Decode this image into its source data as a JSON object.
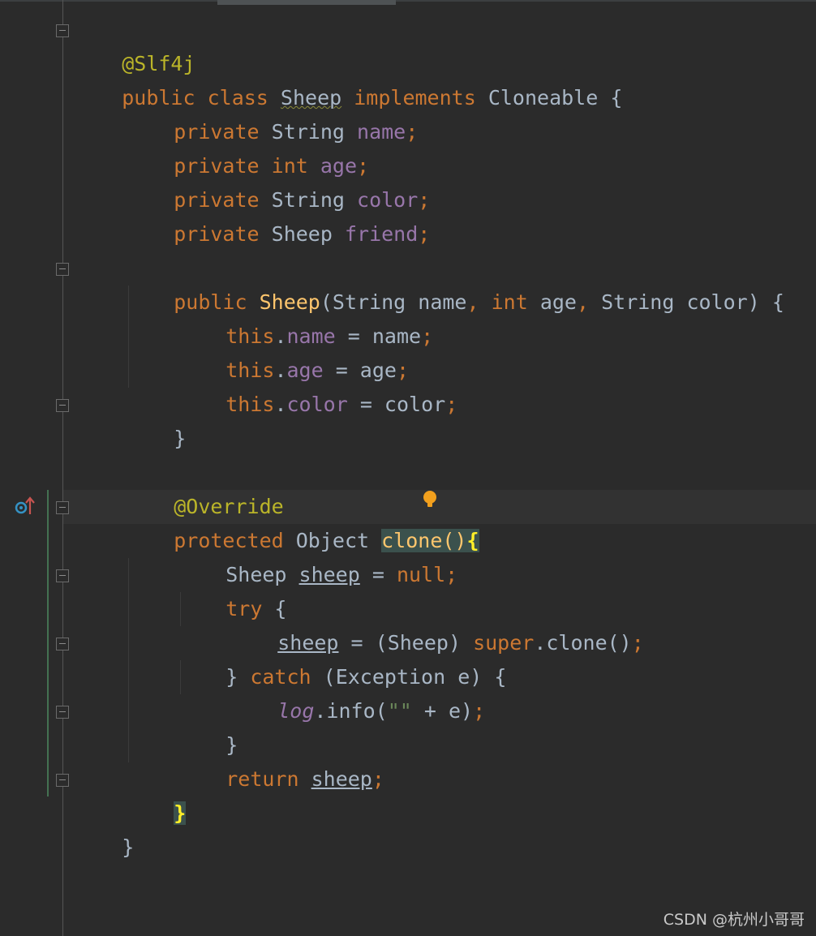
{
  "lines": {
    "l1": {
      "ann": "@Slf4j"
    },
    "l2": {
      "public": "public",
      "cls": "class",
      "name": "Sheep",
      "impl": "implements",
      "iface": "Cloneable",
      "brace": "{"
    },
    "l3": {
      "kw": "private",
      "type": "String",
      "field": "name",
      "semi": ";"
    },
    "l4": {
      "kw": "private",
      "type": "int",
      "field": "age",
      "semi": ";"
    },
    "l5": {
      "kw": "private",
      "type": "String",
      "field": "color",
      "semi": ";"
    },
    "l6": {
      "kw": "private",
      "type": "Sheep",
      "field": "friend",
      "semi": ";"
    },
    "l8": {
      "kw": "public",
      "fn": "Sheep",
      "p1": "(String name",
      "c1": ",",
      "int": " int",
      "p2": " age",
      "c2": ",",
      "p3": " String color) {"
    },
    "l9": {
      "this": "this",
      "dot": ".",
      "field": "name",
      "rest": " = name",
      "semi": ";"
    },
    "l10": {
      "this": "this",
      "dot": ".",
      "field": "age",
      "rest": " = age",
      "semi": ";"
    },
    "l11": {
      "this": "this",
      "dot": ".",
      "field": "color",
      "rest": " = color",
      "semi": ";"
    },
    "l12": {
      "brace": "}"
    },
    "l14": {
      "ann": "@Override"
    },
    "l15": {
      "kw": "protected",
      "type": " Object ",
      "fn": "clone",
      "paren": "()",
      "brace": "{"
    },
    "l16": {
      "type": "Sheep ",
      "var": "sheep",
      "eq": " = ",
      "null": "null",
      "semi": ";"
    },
    "l17": {
      "kw": "try",
      "brace": " {"
    },
    "l18": {
      "var": "sheep",
      "eq": " = (Sheep) ",
      "sup": "super",
      "call": ".clone()",
      "semi": ";"
    },
    "l19": {
      "close": "} ",
      "kw": "catch",
      "rest": " (Exception e) {"
    },
    "l20": {
      "log": "log",
      "call": ".info(",
      "str": "\"\"",
      "rest": " + e)",
      "semi": ";"
    },
    "l21": {
      "brace": "}"
    },
    "l22": {
      "kw": "return",
      "sp": " ",
      "var": "sheep",
      "semi": ";"
    },
    "l23": {
      "brace": "}"
    },
    "l24": {
      "brace": "}"
    }
  },
  "icons": {
    "override": "override-gutter-icon",
    "bulb": "intention-bulb-icon"
  },
  "watermark": "CSDN @杭州小哥哥"
}
